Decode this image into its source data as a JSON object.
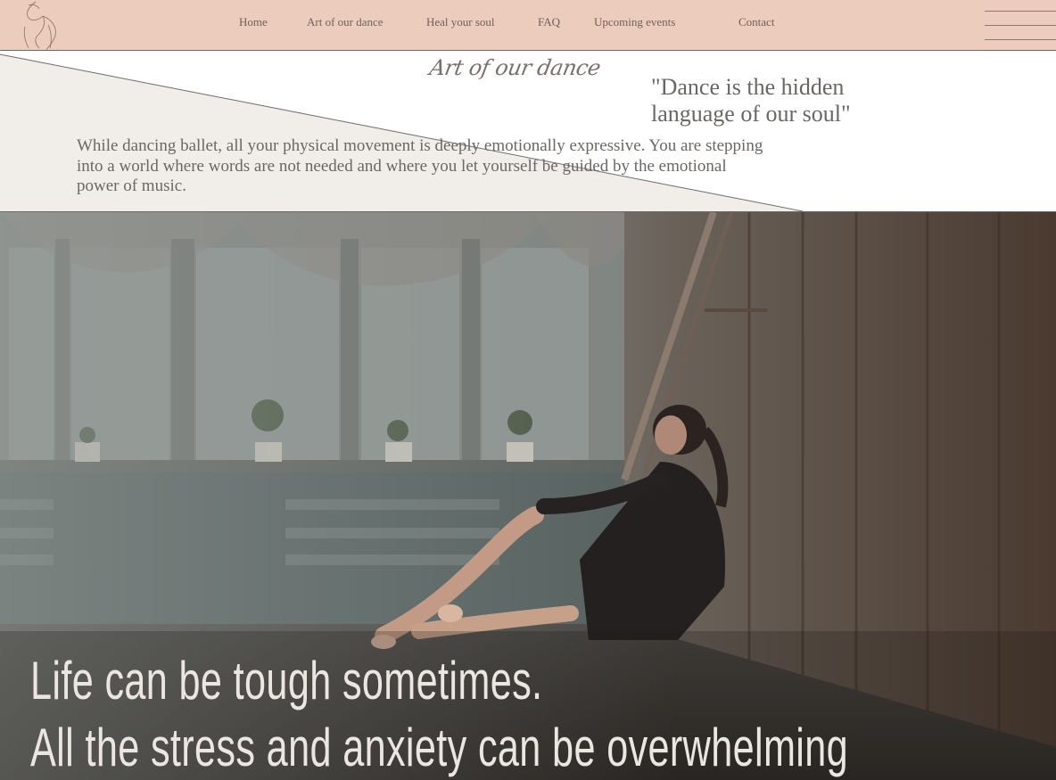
{
  "nav": {
    "items": [
      {
        "label": "Home"
      },
      {
        "label": "Art of our dance"
      },
      {
        "label": "Heal your soul"
      },
      {
        "label": "FAQ"
      },
      {
        "label": "Upcoming events"
      },
      {
        "label": "Contact"
      }
    ],
    "menu_icon": "hamburger-menu-icon",
    "logo_icon": "dancer-line-art-logo"
  },
  "intro": {
    "title": "Art of our dance",
    "quote": "\"Dance is the hidden language of our soul\"",
    "body": "While dancing ballet, all your physical movement is deeply emotionally expressive. You are stepping into a world where words are not needed and where you let yourself be guided by the emotional power of music."
  },
  "hero": {
    "image": "ballerina-sitting-by-barre-photo",
    "headline_line1": "Life can be tough sometimes.",
    "headline_line2": "All the stress and anxiety can be overwhelming"
  },
  "colors": {
    "header_bg": "#ecccbc",
    "intro_panel": "#f1ede9",
    "nav_text": "#6d625b",
    "headline_text": "#ece6e2"
  }
}
